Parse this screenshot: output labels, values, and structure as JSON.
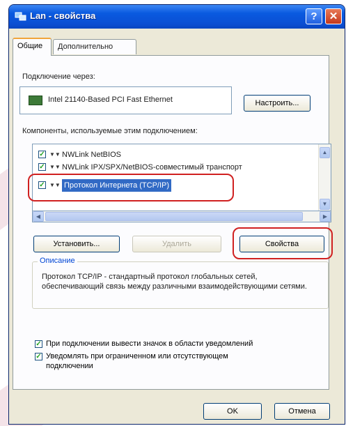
{
  "window": {
    "title": "Lan - свойства",
    "help_label": "?",
    "close_label": "✕"
  },
  "tabs": [
    {
      "label": "Общие",
      "active": true
    },
    {
      "label": "Дополнительно",
      "active": false
    }
  ],
  "connection": {
    "label": "Подключение через:",
    "adapter_name": "Intel 21140-Based PCI Fast Ethernet",
    "configure_button": "Настроить..."
  },
  "components": {
    "label": "Компоненты, используемые этим подключением:",
    "items": [
      {
        "name": "NWLink NetBIOS",
        "checked": true,
        "selected": false
      },
      {
        "name": "NWLink IPX/SPX/NetBIOS-совместимый транспорт",
        "checked": true,
        "selected": false
      },
      {
        "name": "Протокол Интернета (TCP/IP)",
        "checked": true,
        "selected": true
      }
    ]
  },
  "buttons": {
    "install": "Установить...",
    "remove": "Удалить",
    "properties": "Свойства",
    "ok": "OK",
    "cancel": "Отмена"
  },
  "description": {
    "legend": "Описание",
    "text": "Протокол TCP/IP - стандартный протокол глобальных сетей, обеспечивающий связь между различными взаимодействующими сетями."
  },
  "options": [
    {
      "label": "При подключении вывести значок в области уведомлений",
      "checked": true
    },
    {
      "label": "Уведомлять при ограниченном или отсутствующем подключении",
      "checked": true
    }
  ],
  "colors": {
    "titlebar": "#0b4fd3",
    "selection": "#316ac5",
    "highlight_ring": "#d02020",
    "watermark": "#f2dfe4"
  },
  "icons": {
    "titlebar": "network-connection-icon",
    "adapter": "network-adapter-icon",
    "component": "protocol-icon"
  }
}
